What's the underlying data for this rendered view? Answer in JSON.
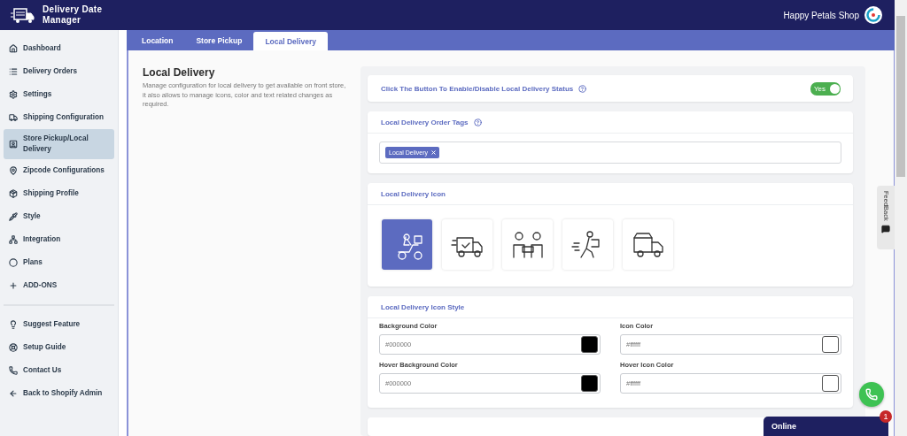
{
  "header": {
    "app_name": "Delivery Date Manager",
    "shop_name": "Happy Petals Shop"
  },
  "sidebar": {
    "items": [
      {
        "label": "Dashboard",
        "selected": false
      },
      {
        "label": "Delivery Orders",
        "selected": false
      },
      {
        "label": "Settings",
        "selected": false
      },
      {
        "label": "Shipping Configuration",
        "selected": false
      },
      {
        "label": "Store Pickup/Local Delivery",
        "selected": true
      },
      {
        "label": "Zipcode Configurations",
        "selected": false
      },
      {
        "label": "Shipping Profile",
        "selected": false
      },
      {
        "label": "Style",
        "selected": false
      },
      {
        "label": "Integration",
        "selected": false
      },
      {
        "label": "Plans",
        "selected": false
      },
      {
        "label": "ADD-ONS",
        "selected": false
      }
    ],
    "footer_items": [
      {
        "label": "Suggest Feature"
      },
      {
        "label": "Setup Guide"
      },
      {
        "label": "Contact Us"
      },
      {
        "label": "Back to Shopify Admin"
      }
    ]
  },
  "tabs": [
    {
      "label": "Location",
      "selected": false
    },
    {
      "label": "Store Pickup",
      "selected": false
    },
    {
      "label": "Local Delivery",
      "selected": true
    }
  ],
  "intro": {
    "title": "Local Delivery",
    "description": "Manage configuration for local delivery to get available on front store, it also allows to manage icons, color and text related changes as required."
  },
  "status_card": {
    "label": "Click The Button To Enable/Disable Local Delivery Status",
    "toggle": {
      "on": true,
      "text": "Yes"
    }
  },
  "tags_card": {
    "title": "Local Delivery Order Tags",
    "tags": [
      "Local Delivery"
    ]
  },
  "icon_card": {
    "title": "Local Delivery Icon",
    "options": [
      {
        "selected": true
      },
      {
        "selected": false
      },
      {
        "selected": false
      },
      {
        "selected": false
      },
      {
        "selected": false
      }
    ]
  },
  "style_card": {
    "title": "Local Delivery Icon Style",
    "fields": [
      {
        "label": "Background Color",
        "value": "#000000",
        "color": "#000000"
      },
      {
        "label": "Icon Color",
        "value": "#ffffff",
        "color": "#ffffff"
      },
      {
        "label": "Hover Background Color",
        "value": "#000000",
        "color": "#000000"
      },
      {
        "label": "Hover Icon Color",
        "value": "#ffffff",
        "color": "#ffffff"
      }
    ]
  },
  "feedback": {
    "label": "FeedBack"
  },
  "chat": {
    "status": "Online",
    "badge": "1"
  }
}
